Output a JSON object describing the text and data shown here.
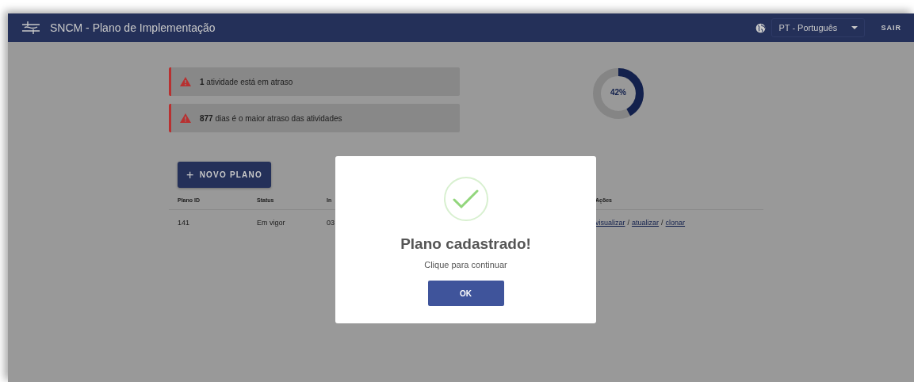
{
  "header": {
    "title": "SNCM - Plano de Implementação",
    "language": "PT - Português",
    "logout": "SAIR"
  },
  "alerts": [
    {
      "count": "1",
      "text": "atividade está em atraso"
    },
    {
      "count": "877",
      "text": "dias é o maior atraso das atividades"
    }
  ],
  "progress": {
    "level": 0.42,
    "label": "42%"
  },
  "new_plan_button": {
    "icon": "+",
    "label": "NOVO PLANO"
  },
  "table": {
    "columns": [
      "Plano ID",
      "Status",
      "In",
      "Ações"
    ],
    "rows": [
      {
        "id": "141",
        "status": "Em vigor",
        "column_3": "03",
        "actions": [
          "visualizar",
          "atualizar",
          "clonar"
        ],
        "separator": "/"
      }
    ]
  },
  "dialog": {
    "title": "Plano cadastrado!",
    "message": "Clique para continuar",
    "button": "OK"
  }
}
